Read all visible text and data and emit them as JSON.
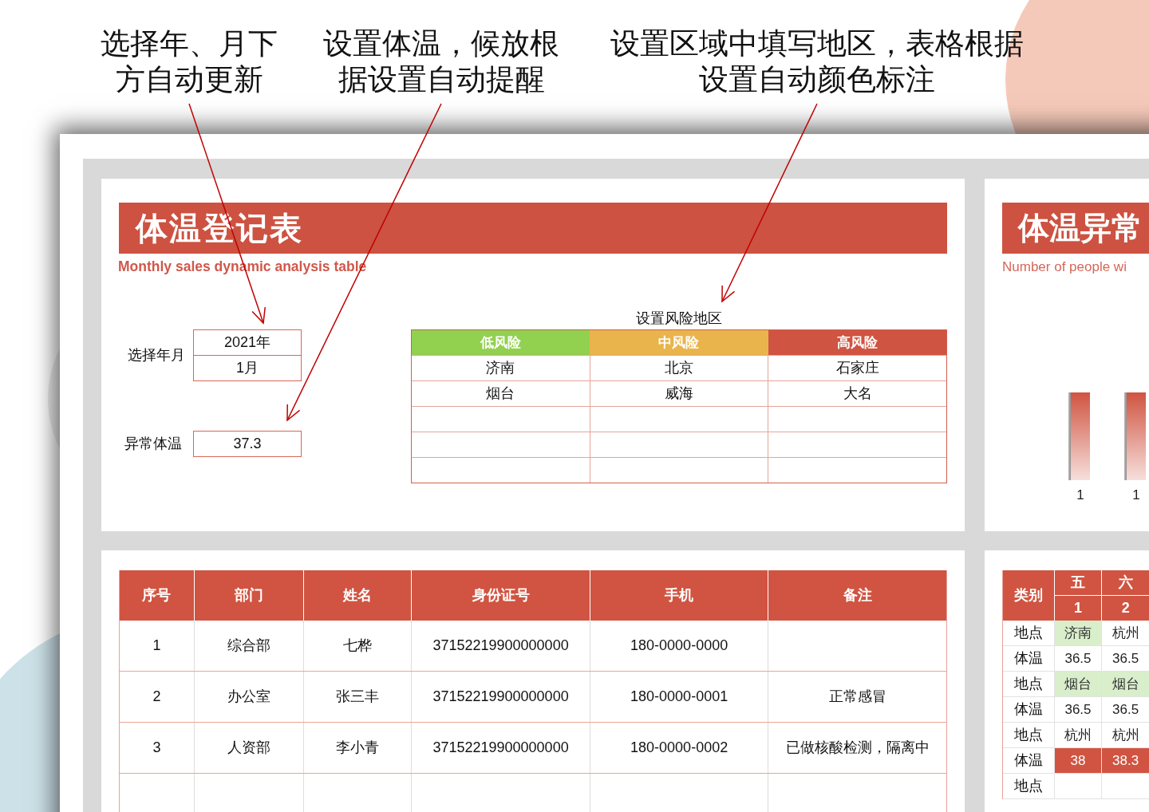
{
  "annotations": [
    {
      "text": "选择年、月下方自动更新"
    },
    {
      "text": "设置体温，候放根据设置自动提醒"
    },
    {
      "text": "设置区域中填写地区，表格根据设置自动颜色标注"
    }
  ],
  "register_panel": {
    "title": "体温登记表",
    "subtitle": "Monthly sales dynamic analysis table",
    "month_picker": {
      "label": "选择年月",
      "year": "2021年",
      "month": "1月"
    },
    "threshold": {
      "label": "异常体温",
      "value": "37.3"
    },
    "risk_table": {
      "title": "设置风险地区",
      "columns": [
        {
          "label": "低风险",
          "color": "#92d050"
        },
        {
          "label": "中风险",
          "color": "#e9b44c"
        },
        {
          "label": "高风险",
          "color": "#cf5441"
        }
      ],
      "rows": [
        [
          "济南",
          "北京",
          "石家庄"
        ],
        [
          "烟台",
          "威海",
          "大名"
        ]
      ]
    }
  },
  "abnormal_panel": {
    "title": "体温异常",
    "subtitle": "Number of people wi",
    "bars": [
      {
        "label": "1"
      },
      {
        "label": "1"
      }
    ]
  },
  "register_table": {
    "columns": [
      "序号",
      "部门",
      "姓名",
      "身份证号",
      "手机",
      "备注"
    ],
    "rows": [
      {
        "cells": [
          "1",
          "综合部",
          "七桦",
          "37152219900000000",
          "180-0000-0000"
        ]
      },
      {
        "cells": [
          "2",
          "办公室",
          "张三丰",
          "37152219900000000",
          "180-0000-0001",
          "正常感冒"
        ]
      },
      {
        "cells": [
          "3",
          "人资部",
          "李小青",
          "37152219900000000",
          "180-0000-0002",
          "已做核酸检测，隔离中"
        ]
      }
    ]
  },
  "schedule_table": {
    "corner": "类别",
    "columns": [
      {
        "weekday": "五",
        "day": "1"
      },
      {
        "weekday": "六",
        "day": "2"
      }
    ],
    "rows": [
      {
        "kind": "location",
        "label": "地点",
        "cells": [
          {
            "text": "济南",
            "highlight": true
          },
          {
            "text": "杭州",
            "highlight": false
          }
        ]
      },
      {
        "kind": "temperature",
        "label": "体温",
        "cells": [
          {
            "text": "36.5",
            "highlight": false
          },
          {
            "text": "36.5",
            "highlight": false
          }
        ]
      },
      {
        "kind": "location",
        "label": "地点",
        "cells": [
          {
            "text": "烟台",
            "highlight": true
          },
          {
            "text": "烟台",
            "highlight": true
          }
        ]
      },
      {
        "kind": "temperature",
        "label": "体温",
        "cells": [
          {
            "text": "36.5",
            "highlight": false
          },
          {
            "text": "36.5",
            "highlight": false
          }
        ]
      },
      {
        "kind": "location",
        "label": "地点",
        "cells": [
          {
            "text": "杭州",
            "highlight": false
          },
          {
            "text": "杭州",
            "highlight": false
          }
        ]
      },
      {
        "kind": "temperature",
        "label": "体温",
        "cells": [
          {
            "text": "38",
            "highlight": true
          },
          {
            "text": "38.3",
            "highlight": true
          }
        ]
      },
      {
        "kind": "location",
        "label": "地点"
      }
    ]
  }
}
